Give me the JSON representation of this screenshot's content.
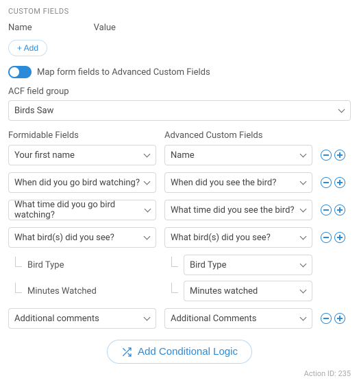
{
  "section_title": "CUSTOM FIELDS",
  "name_header": "Name",
  "value_header": "Value",
  "add_label": "+ Add",
  "map_toggle_label": "Map form fields to Advanced Custom Fields",
  "acf_group_label": "ACF field group",
  "acf_group_value": "Birds Saw",
  "col_left_header": "Formidable Fields",
  "col_right_header": "Advanced Custom Fields",
  "map_rows": [
    {
      "left": "Your first name",
      "right": "Name"
    },
    {
      "left": "When did you go bird watching?",
      "right": "When did you see the bird?"
    },
    {
      "left": "What time did you go bird watching?",
      "right": "What time did you see the bird?"
    },
    {
      "left": "What bird(s) did you see?",
      "right": "What bird(s) did you see?"
    }
  ],
  "sub_rows": [
    {
      "left_label": "Bird Type",
      "right_value": "Bird Type"
    },
    {
      "left_label": "Minutes Watched",
      "right_value": "Minutes watched"
    }
  ],
  "last_row": {
    "left": "Additional comments",
    "right": "Additional Comments"
  },
  "conditional_label": "Add Conditional Logic",
  "footer_text": "Action ID: 235"
}
